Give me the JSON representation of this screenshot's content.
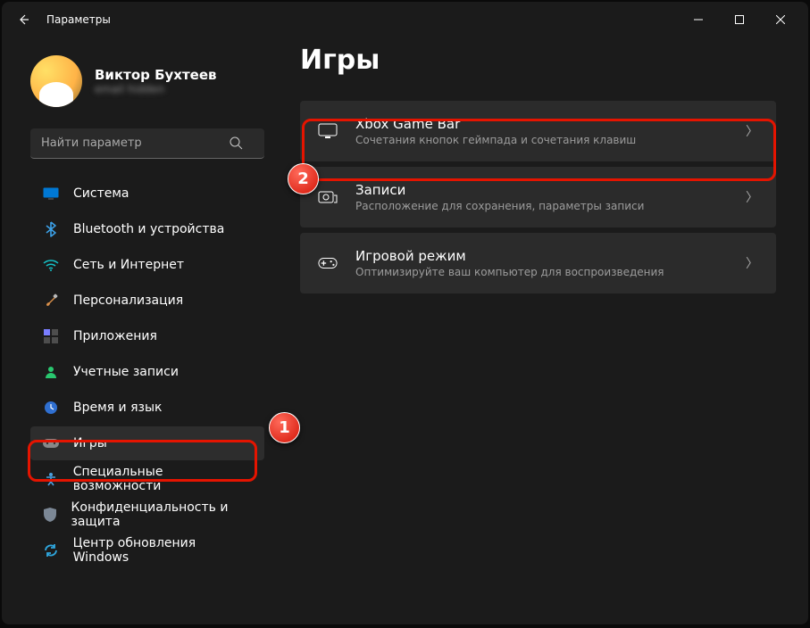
{
  "app": {
    "title": "Параметры"
  },
  "profile": {
    "name": "Виктор Бухтеев",
    "email": "email hidden"
  },
  "search": {
    "placeholder": "Найти параметр"
  },
  "sidebar": {
    "items": [
      {
        "label": "Система"
      },
      {
        "label": "Bluetooth и устройства"
      },
      {
        "label": "Сеть и Интернет"
      },
      {
        "label": "Персонализация"
      },
      {
        "label": "Приложения"
      },
      {
        "label": "Учетные записи"
      },
      {
        "label": "Время и язык"
      },
      {
        "label": "Игры"
      },
      {
        "label": "Специальные возможности"
      },
      {
        "label": "Конфиденциальность и защита"
      },
      {
        "label": "Центр обновления Windows"
      }
    ]
  },
  "page": {
    "title": "Игры"
  },
  "cards": [
    {
      "title": "Xbox Game Bar",
      "sub": "Сочетания кнопок геймпада и сочетания клавиш"
    },
    {
      "title": "Записи",
      "sub": "Расположение для сохранения, параметры записи"
    },
    {
      "title": "Игровой режим",
      "sub": "Оптимизируйте ваш компьютер для воспроизведения"
    }
  ],
  "annotations": {
    "badge1": "1",
    "badge2": "2"
  }
}
